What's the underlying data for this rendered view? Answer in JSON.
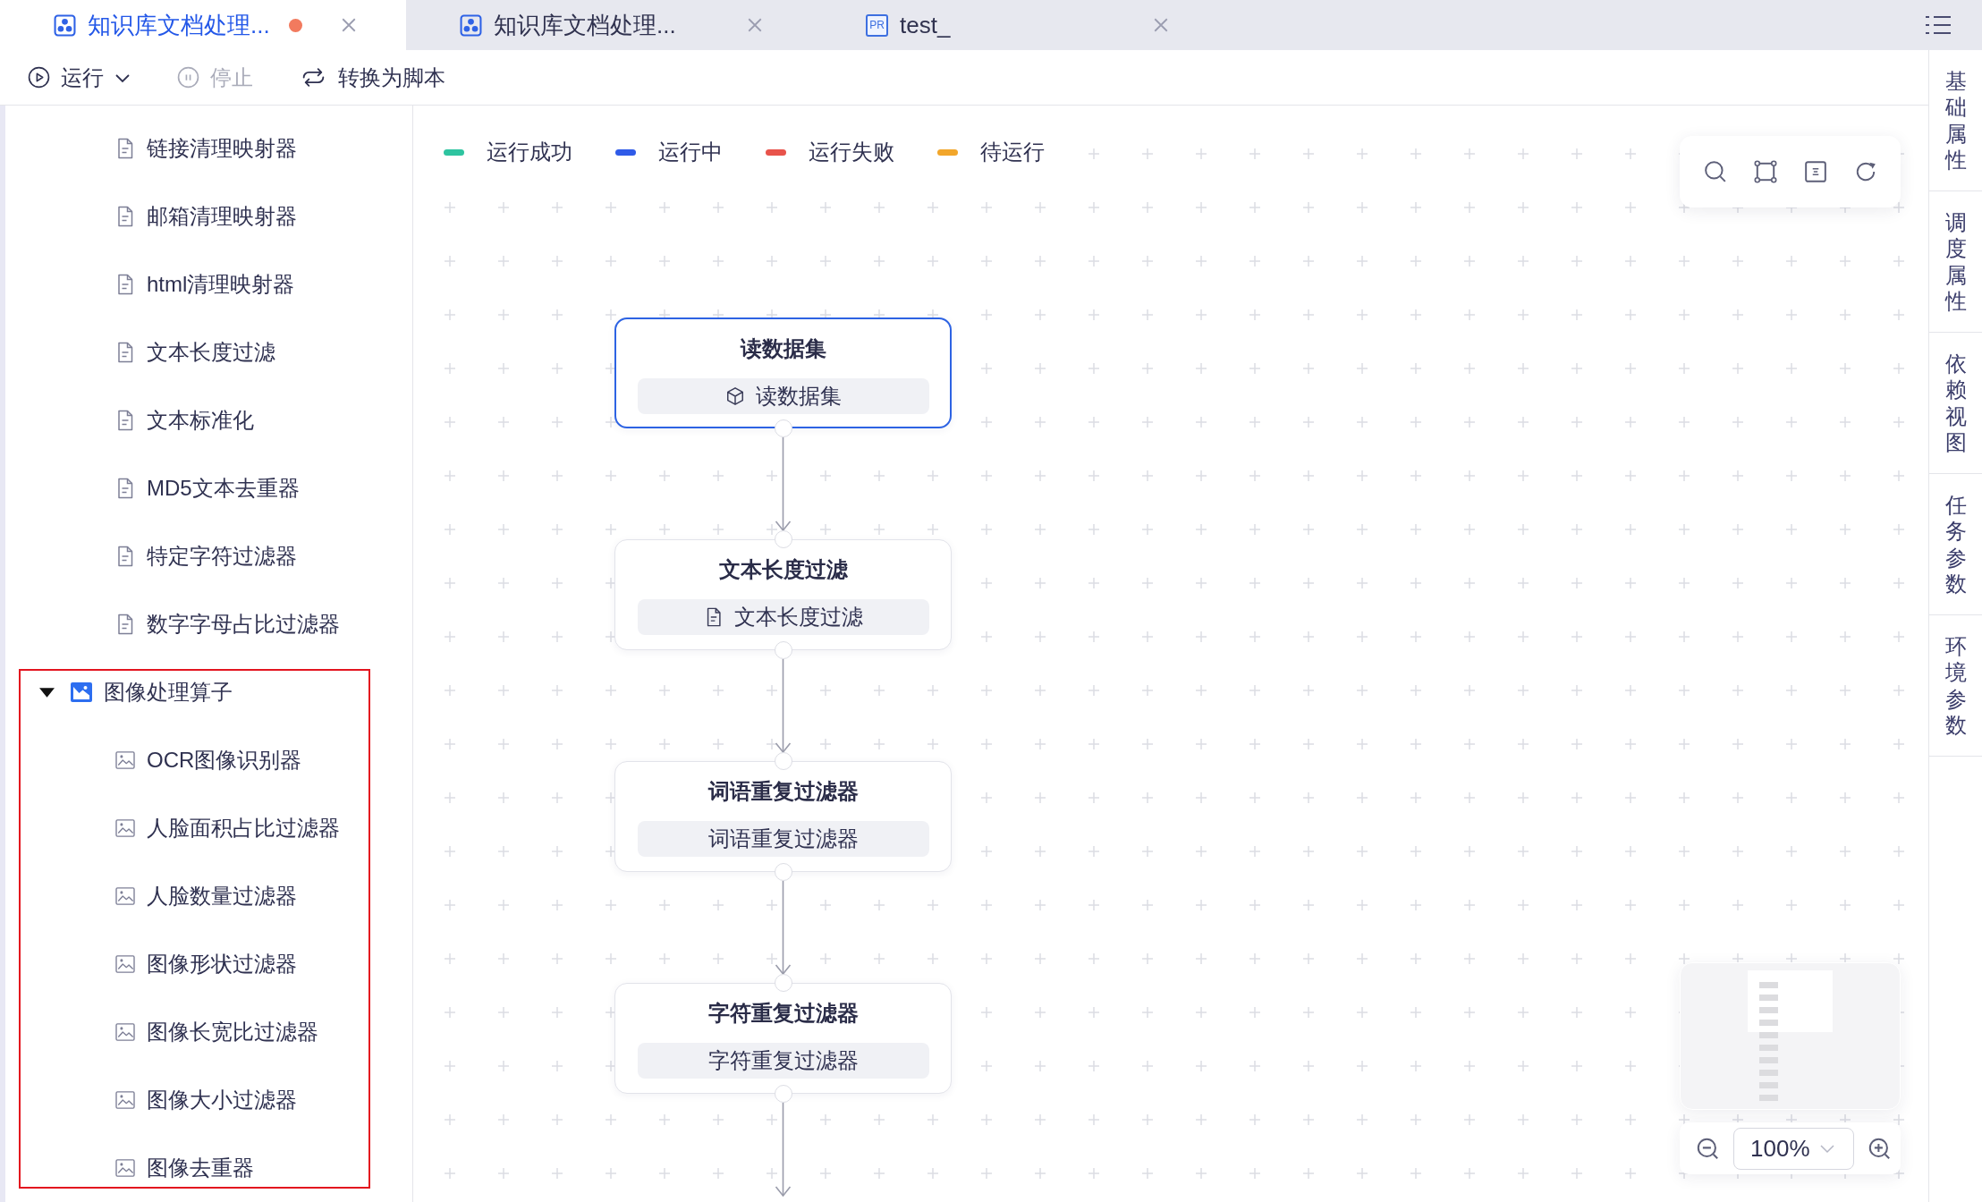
{
  "tabs": [
    {
      "title": "知识库文档处理...",
      "kind": "flow",
      "selected": true,
      "modified": true
    },
    {
      "title": "知识库文档处理...",
      "kind": "flow",
      "selected": false,
      "modified": false
    },
    {
      "title": "test_",
      "kind": "script",
      "badge": "PR",
      "selected": false,
      "modified": false
    }
  ],
  "toolbar": [
    {
      "label": "运行",
      "kind": "run",
      "disabled": false,
      "has_menu": true
    },
    {
      "label": "停止",
      "kind": "stop",
      "disabled": true,
      "has_menu": false
    },
    {
      "label": "转换为脚本",
      "kind": "convert",
      "disabled": false,
      "has_menu": false
    }
  ],
  "sidebar": {
    "items": [
      {
        "label": "链接清理映射器",
        "kind": "text"
      },
      {
        "label": "邮箱清理映射器",
        "kind": "text"
      },
      {
        "label": "html清理映射器",
        "kind": "text"
      },
      {
        "label": "文本长度过滤",
        "kind": "text"
      },
      {
        "label": "文本标准化",
        "kind": "text"
      },
      {
        "label": "MD5文本去重器",
        "kind": "text"
      },
      {
        "label": "特定字符过滤器",
        "kind": "text"
      },
      {
        "label": "数字字母占比过滤器",
        "kind": "text"
      },
      {
        "label": "图像处理算子",
        "kind": "group",
        "expanded": true,
        "highlighted": true,
        "children": [
          {
            "label": "OCR图像识别器",
            "kind": "image"
          },
          {
            "label": "人脸面积占比过滤器",
            "kind": "image"
          },
          {
            "label": "人脸数量过滤器",
            "kind": "image"
          },
          {
            "label": "图像形状过滤器",
            "kind": "image"
          },
          {
            "label": "图像长宽比过滤器",
            "kind": "image"
          },
          {
            "label": "图像大小过滤器",
            "kind": "image"
          },
          {
            "label": "图像去重器",
            "kind": "image"
          }
        ]
      }
    ]
  },
  "legend": [
    {
      "label": "运行成功",
      "color": "#2ec4a0"
    },
    {
      "label": "运行中",
      "color": "#2f5be8"
    },
    {
      "label": "运行失败",
      "color": "#e8534b"
    },
    {
      "label": "待运行",
      "color": "#f2a62b"
    }
  ],
  "flow": {
    "nodes": [
      {
        "title": "读数据集",
        "label": "读数据集",
        "kind": "dataset",
        "selected": true
      },
      {
        "title": "文本长度过滤",
        "label": "文本长度过滤",
        "kind": "text",
        "selected": false
      },
      {
        "title": "词语重复过滤器",
        "label": "词语重复过滤器",
        "kind": "plain",
        "selected": false
      },
      {
        "title": "字符重复过滤器",
        "label": "字符重复过滤器",
        "kind": "plain",
        "selected": false
      }
    ],
    "continues_below": true
  },
  "zoom": {
    "value": "100%"
  },
  "panel_tabs": [
    {
      "label": "基础属性",
      "selected": false
    },
    {
      "label": "调度属性",
      "selected": false
    },
    {
      "label": "依赖视图",
      "selected": false
    },
    {
      "label": "任务参数",
      "selected": false
    },
    {
      "label": "环境参数",
      "selected": false
    }
  ]
}
